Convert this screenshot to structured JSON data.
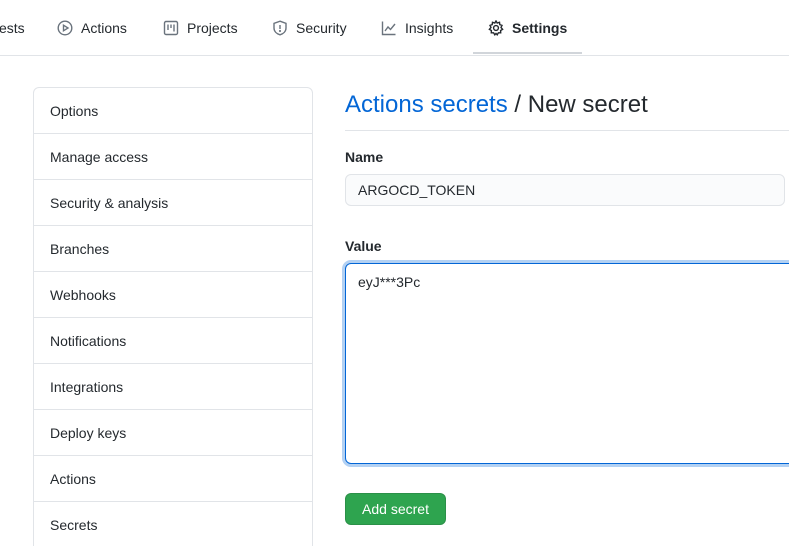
{
  "nav": {
    "tabs": [
      {
        "label": "ests",
        "icon": "pull-request-icon",
        "selected": false
      },
      {
        "label": "Actions",
        "icon": "play-circle-icon",
        "selected": false
      },
      {
        "label": "Projects",
        "icon": "project-board-icon",
        "selected": false
      },
      {
        "label": "Security",
        "icon": "shield-icon",
        "selected": false
      },
      {
        "label": "Insights",
        "icon": "graph-icon",
        "selected": false
      },
      {
        "label": "Settings",
        "icon": "gear-icon",
        "selected": true
      }
    ]
  },
  "sidebar": {
    "items": [
      {
        "label": "Options"
      },
      {
        "label": "Manage access"
      },
      {
        "label": "Security & analysis"
      },
      {
        "label": "Branches"
      },
      {
        "label": "Webhooks"
      },
      {
        "label": "Notifications"
      },
      {
        "label": "Integrations"
      },
      {
        "label": "Deploy keys"
      },
      {
        "label": "Actions"
      },
      {
        "label": "Secrets"
      }
    ]
  },
  "main": {
    "breadcrumb_link": "Actions secrets",
    "breadcrumb_separator": " / ",
    "breadcrumb_current": "New secret",
    "name_label": "Name",
    "name_value": "ARGOCD_TOKEN",
    "value_label": "Value",
    "value_value": "eyJ***3Pc",
    "submit_label": "Add secret"
  },
  "colors": {
    "link": "#0366d6",
    "primary_button": "#2ea44f",
    "border": "#e1e4e8",
    "focus_ring": "#0366d6"
  }
}
